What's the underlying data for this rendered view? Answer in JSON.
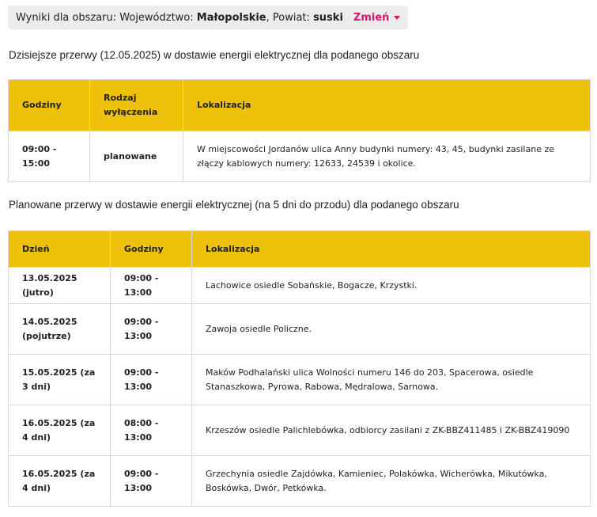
{
  "area": {
    "prefix": "Wyniki dla obszaru: Województwo:",
    "voivodeship": "Małopolskie",
    "county_label": ", Powiat:",
    "county": "suski",
    "change_label": "Zmień"
  },
  "today": {
    "title": "Dzisiejsze przerwy (12.05.2025) w dostawie energii elektrycznej dla podanego obszaru",
    "headers": [
      "Godziny",
      "Rodzaj wyłączenia",
      "Lokalizacja"
    ],
    "rows": [
      {
        "hours": "09:00 - 15:00",
        "type": "planowane",
        "location": "W miejscowości Jordanów ulica Anny budynki numery: 43, 45, budynki zasilane ze złączy kablowych numery: 12633, 24539 i okolice."
      }
    ]
  },
  "planned": {
    "title": "Planowane przerwy w dostawie energii elektrycznej (na 5 dni do przodu) dla podanego obszaru",
    "headers": [
      "Dzień",
      "Godziny",
      "Lokalizacja"
    ],
    "rows": [
      {
        "day": "13.05.2025 (jutro)",
        "hours": "09:00 - 13:00",
        "location": "Lachowice osiedle Sobańskie, Bogacze, Krzystki."
      },
      {
        "day": "14.05.2025 (pojutrze)",
        "hours": "09:00 - 13:00",
        "location": "Zawoja osiedle Policzne."
      },
      {
        "day": "15.05.2025 (za 3 dni)",
        "hours": "09:00 - 13:00",
        "location": "Maków Podhalański ulica Wolności numeru 146 do 203, Spacerowa, osiedle Stanaszkowa, Pyrowa, Rabowa, Mędralowa, Sarnowa."
      },
      {
        "day": "16.05.2025 (za 4 dni)",
        "hours": "08:00 - 13:00",
        "location": "Krzeszów osiedle Palichlebówka, odbiorcy zasilani z ZK-BBZ411485 i ZK-BBZ419090"
      },
      {
        "day": "16.05.2025 (za 4 dni)",
        "hours": "09:00 - 13:00",
        "location": "Grzechynia osiedle Zajdówka, Kamieniec, Polakówka, Wicherówka, Mikutówka, Boskówka, Dwór, Petkówka."
      }
    ]
  },
  "colors": {
    "header_bg": "#eec10a",
    "accent": "#d6166c",
    "pill_bg": "#ececec",
    "border": "#d8d8d8"
  }
}
